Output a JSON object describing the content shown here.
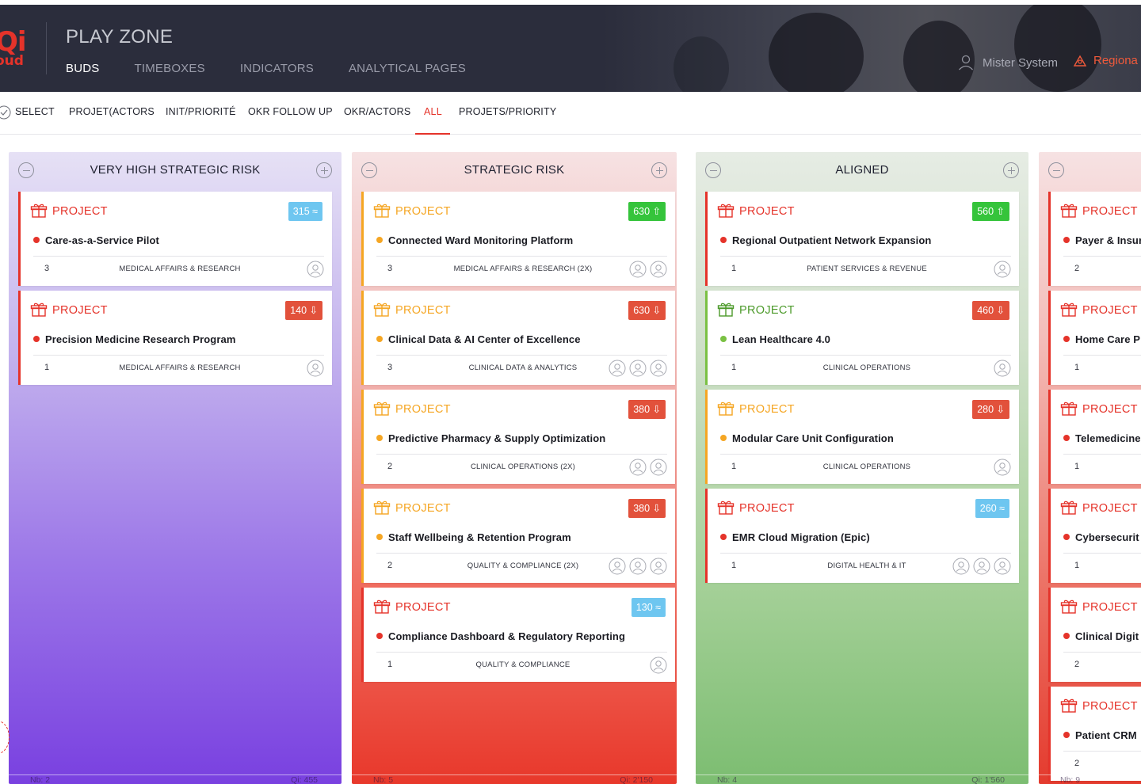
{
  "header": {
    "logo_big": "Qi",
    "logo_small": "oud",
    "app_title": "PLAY ZONE",
    "nav": [
      "BUDS",
      "TIMEBOXES",
      "INDICATORS",
      "ANALYTICAL PAGES"
    ],
    "active_nav": "BUDS",
    "user_name": "Mister System",
    "region": "Regiona"
  },
  "tabs": {
    "items": [
      "SELECT",
      "PROJET(ACTORS",
      "INIT/PRIORITÉ",
      "OKR FOLLOW UP",
      "OKR/ACTORS",
      "ALL",
      "PROJETS/PRIORITY"
    ],
    "active": "ALL"
  },
  "columns": [
    {
      "title": "VERY HIGH STRATEGIC RISK",
      "footer_nb": "Nb: 2",
      "footer_qi": "Qi: 455",
      "cards": [
        {
          "type": "PROJECT",
          "badge": "315 ≈",
          "badge_color": "blue",
          "name": "Care-as-a-Service Pilot",
          "status": "red",
          "count": "3",
          "dept": "MEDICAL AFFAIRS & RESEARCH",
          "avatars": 1
        },
        {
          "type": "PROJECT",
          "badge": "140 ⇩",
          "badge_color": "red",
          "name": "Precision Medicine Research Program",
          "status": "red",
          "count": "1",
          "dept": "MEDICAL AFFAIRS & RESEARCH",
          "avatars": 1
        }
      ]
    },
    {
      "title": "STRATEGIC RISK",
      "footer_nb": "Nb: 5",
      "footer_qi": "Qi: 2'150",
      "cards": [
        {
          "type": "PROJECT",
          "badge": "630 ⇧",
          "badge_color": "green",
          "name": "Connected Ward Monitoring Platform",
          "status": "orange",
          "count": "3",
          "dept": "MEDICAL AFFAIRS & RESEARCH (2X)",
          "avatars": 2
        },
        {
          "type": "PROJECT",
          "badge": "630 ⇩",
          "badge_color": "red",
          "name": "Clinical Data & AI Center of Excellence",
          "status": "orange",
          "count": "3",
          "dept": "CLINICAL DATA & ANALYTICS",
          "avatars": 3
        },
        {
          "type": "PROJECT",
          "badge": "380 ⇩",
          "badge_color": "red",
          "name": "Predictive Pharmacy & Supply Optimization",
          "status": "orange",
          "count": "2",
          "dept": "CLINICAL OPERATIONS (2X)",
          "avatars": 2
        },
        {
          "type": "PROJECT",
          "badge": "380 ⇩",
          "badge_color": "red",
          "name": "Staff Wellbeing & Retention Program",
          "status": "orange",
          "count": "2",
          "dept": "QUALITY & COMPLIANCE (2X)",
          "avatars": 3
        },
        {
          "type": "PROJECT",
          "badge": "130 ≈",
          "badge_color": "blue",
          "name": "Compliance Dashboard & Regulatory Reporting",
          "status": "red",
          "count": "1",
          "dept": "QUALITY & COMPLIANCE",
          "avatars": 1
        }
      ]
    },
    {
      "title": "ALIGNED",
      "footer_nb": "Nb: 4",
      "footer_qi": "Qi: 1'560",
      "cards": [
        {
          "type": "PROJECT",
          "badge": "560 ⇧",
          "badge_color": "green",
          "name": "Regional Outpatient Network Expansion",
          "status": "red",
          "count": "1",
          "dept": "PATIENT SERVICES & REVENUE",
          "avatars": 1
        },
        {
          "type": "PROJECT",
          "badge": "460 ⇩",
          "badge_color": "red",
          "name": "Lean Healthcare 4.0",
          "status": "green",
          "count": "1",
          "dept": "CLINICAL OPERATIONS",
          "avatars": 1
        },
        {
          "type": "PROJECT",
          "badge": "280 ⇩",
          "badge_color": "red",
          "name": "Modular Care Unit Configuration",
          "status": "orange",
          "count": "1",
          "dept": "CLINICAL OPERATIONS",
          "avatars": 1
        },
        {
          "type": "PROJECT",
          "badge": "260 ≈",
          "badge_color": "blue",
          "name": "EMR Cloud Migration (Epic)",
          "status": "red",
          "count": "1",
          "dept": "DIGITAL HEALTH & IT",
          "avatars": 3
        }
      ]
    },
    {
      "title": "",
      "footer_nb": "Nb: 9",
      "footer_qi": "",
      "cards": [
        {
          "type": "PROJECT",
          "name": "Payer & Insur",
          "status": "red",
          "count": "2"
        },
        {
          "type": "PROJECT",
          "name": "Home Care P",
          "status": "red",
          "count": "1"
        },
        {
          "type": "PROJECT",
          "name": "Telemedicine",
          "status": "red",
          "count": "1"
        },
        {
          "type": "PROJECT",
          "name": "Cybersecurit",
          "status": "red",
          "count": "1"
        },
        {
          "type": "PROJECT",
          "name": "Clinical Digit",
          "status": "red",
          "count": "2"
        },
        {
          "type": "PROJECT",
          "name": "Patient CRM",
          "status": "red",
          "count": "2"
        }
      ]
    }
  ],
  "icons": {
    "project": "gift-box-icon",
    "user": "user-icon",
    "region": "alert-icon",
    "avatar": "person-circle-icon"
  }
}
